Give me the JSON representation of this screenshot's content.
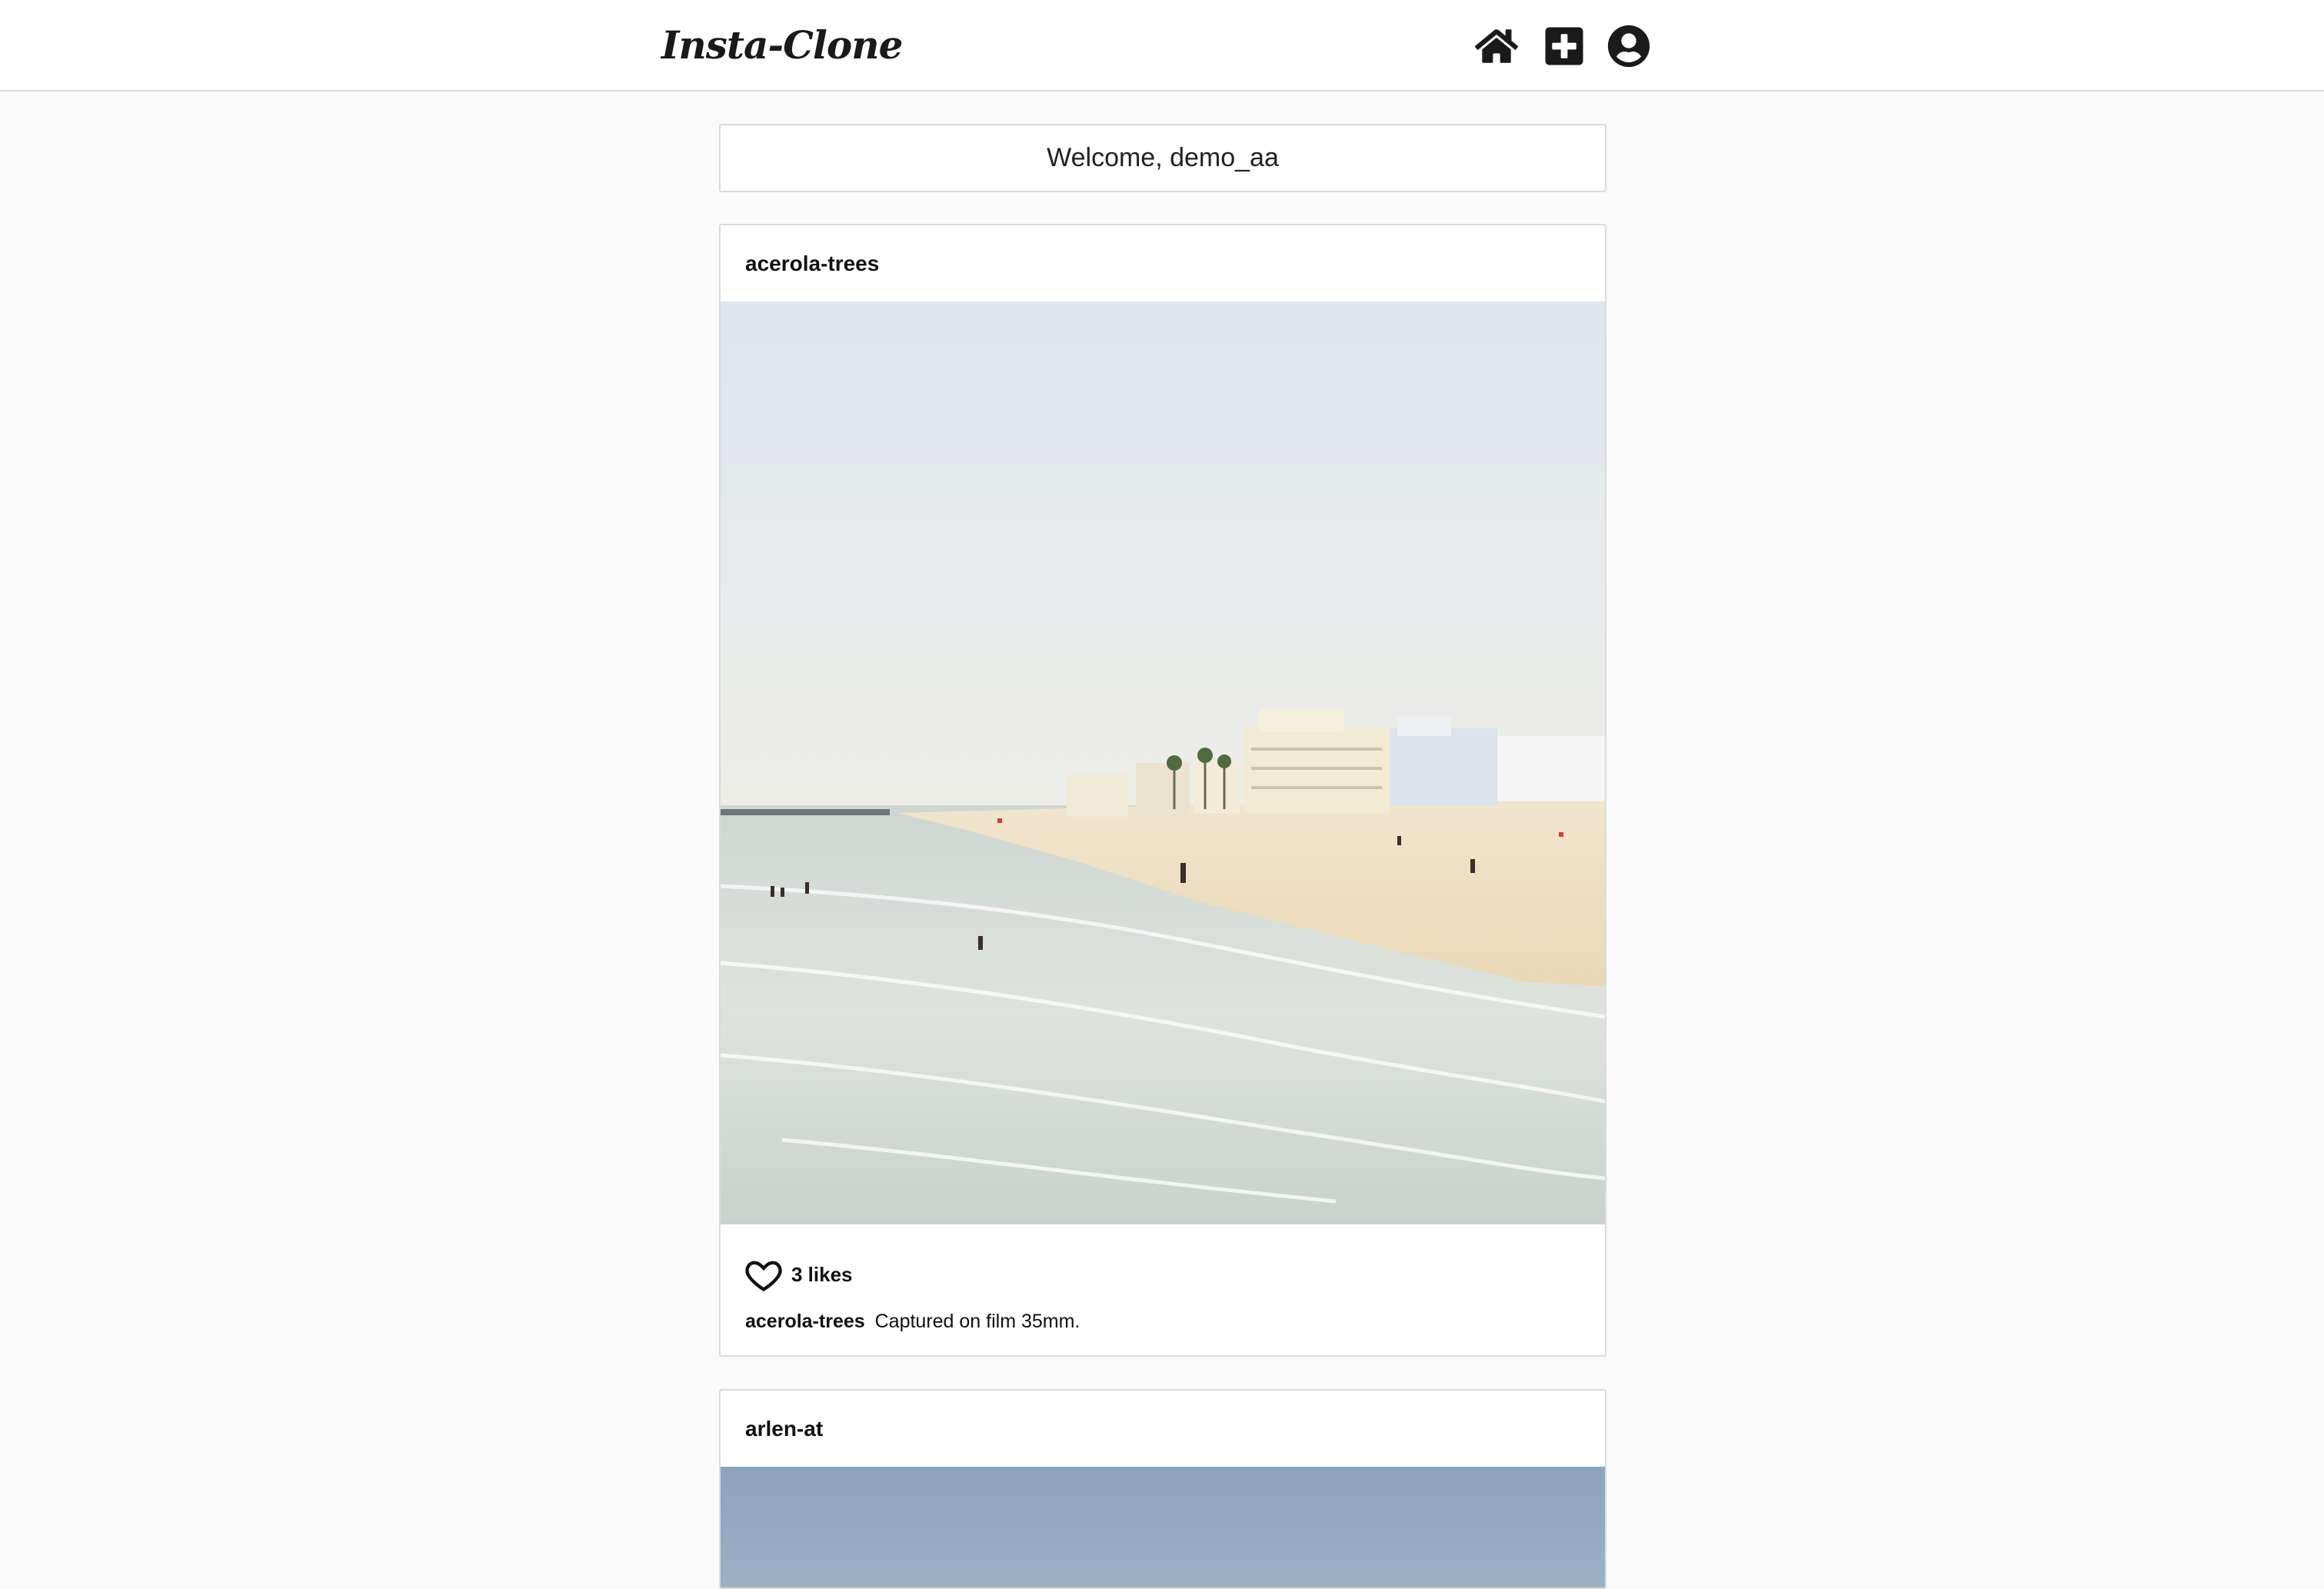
{
  "app": {
    "logo": "Insta-Clone"
  },
  "nav": {
    "icons": [
      "home-icon",
      "add-post-icon",
      "profile-icon"
    ]
  },
  "welcome": {
    "text": "Welcome, demo_aa"
  },
  "posts": [
    {
      "username": "acerola-trees",
      "image": "beach-photo",
      "likes": "3 likes",
      "caption_user": "acerola-trees",
      "caption_text": "Captured on film 35mm."
    },
    {
      "username": "arlen-at",
      "image": "sky-photo"
    }
  ],
  "colors": {
    "background": "#fafafa",
    "card": "#ffffff",
    "border": "#dbdbdb",
    "text": "#111111"
  }
}
